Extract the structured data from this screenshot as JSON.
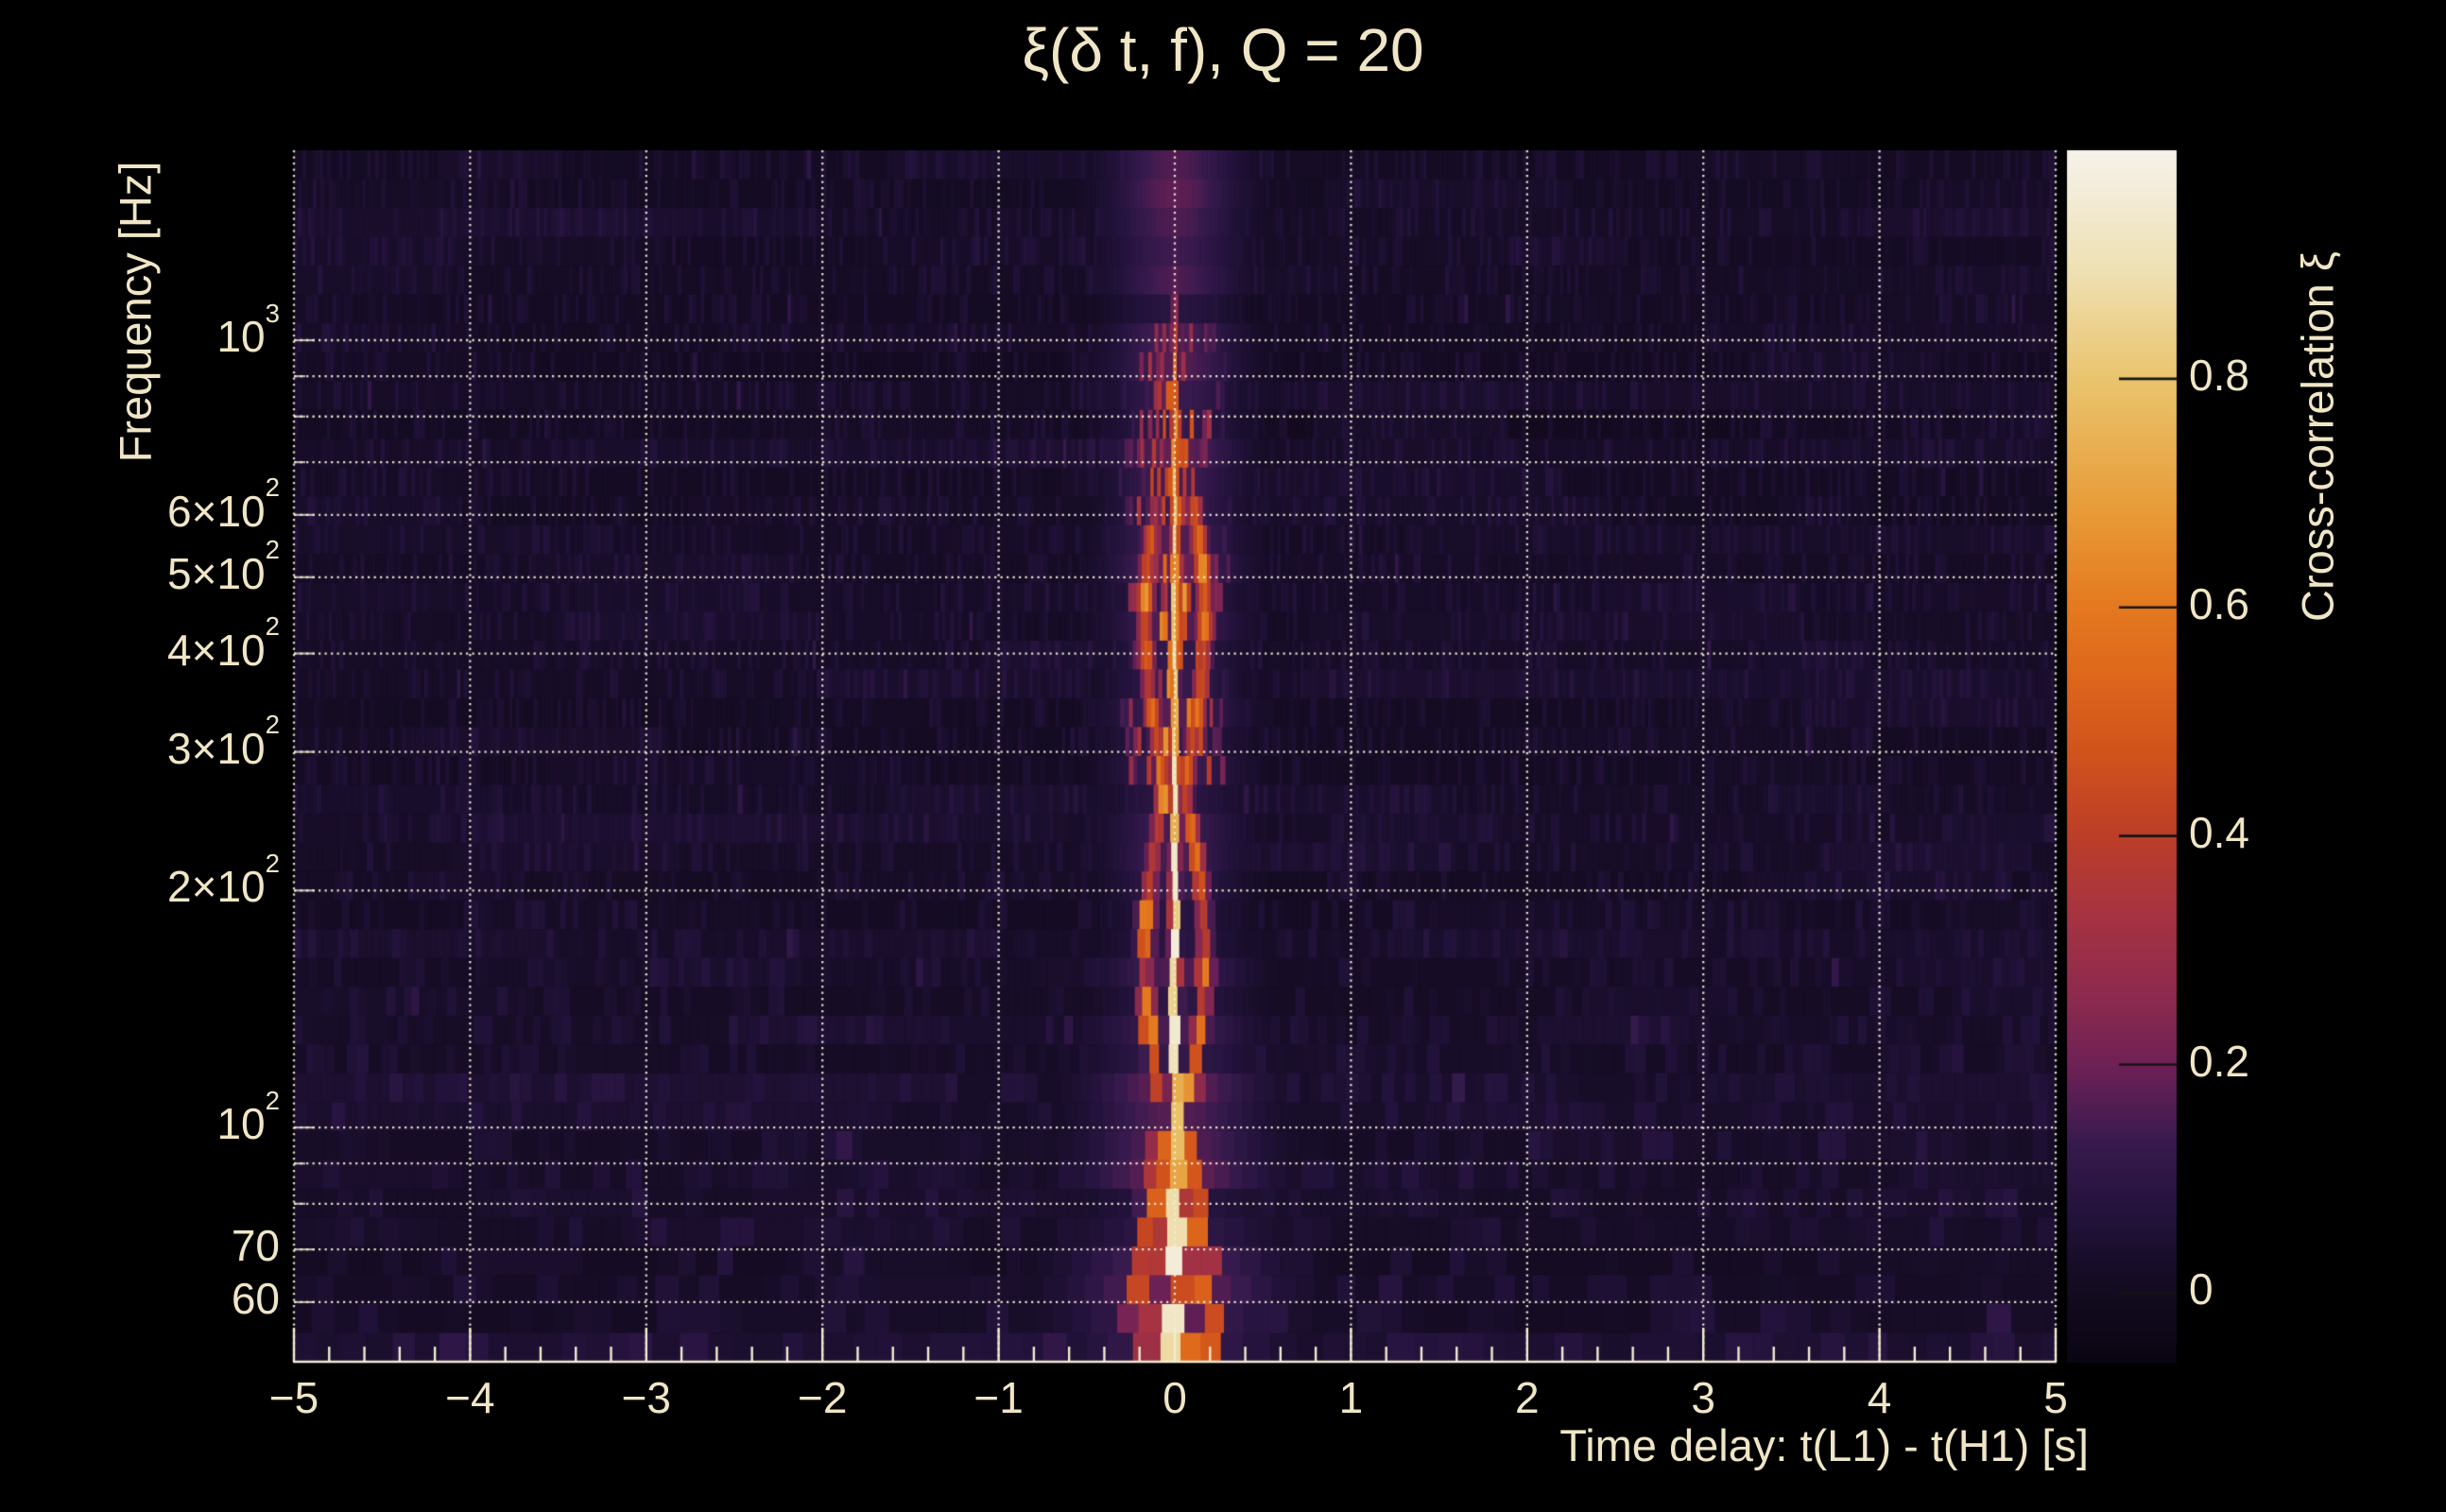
{
  "style": {
    "background": "#000000",
    "text_color": "#f0e6c6",
    "grid_color": "rgba(244,238,214,0.92)",
    "axis_color": "#f3ecd2",
    "colorbar_tick_color": "#141414"
  },
  "chart_data": {
    "type": "heatmap",
    "title": "ξ(δ t, f), Q = 20",
    "xlabel": "Time delay: t(L1) - t(H1) [s]",
    "ylabel": "Frequency [Hz]",
    "x_range": [
      -5,
      5
    ],
    "x_scale": "linear",
    "y_range_hz": [
      50.4,
      1743
    ],
    "y_scale": "log",
    "grid": true,
    "legend": "colorbar-right",
    "x_major_ticks": [
      {
        "v": -5,
        "label": "−5"
      },
      {
        "v": -4,
        "label": "−4"
      },
      {
        "v": -3,
        "label": "−3"
      },
      {
        "v": -2,
        "label": "−2"
      },
      {
        "v": -1,
        "label": "−1"
      },
      {
        "v": 0,
        "label": "0"
      },
      {
        "v": 1,
        "label": "1"
      },
      {
        "v": 2,
        "label": "2"
      },
      {
        "v": 3,
        "label": "3"
      },
      {
        "v": 4,
        "label": "4"
      },
      {
        "v": 5,
        "label": "5"
      }
    ],
    "x_minor_step": 0.2,
    "y_tick_labels": [
      {
        "value": 1000,
        "base": "10",
        "exp": "3"
      },
      {
        "value": 600,
        "base": "6×10",
        "exp": "2"
      },
      {
        "value": 500,
        "base": "5×10",
        "exp": "2"
      },
      {
        "value": 400,
        "base": "4×10",
        "exp": "2"
      },
      {
        "value": 300,
        "base": "3×10",
        "exp": "2"
      },
      {
        "value": 200,
        "base": "2×10",
        "exp": "2"
      },
      {
        "value": 100,
        "base": "10",
        "exp": "2"
      },
      {
        "value": 70,
        "base": "70",
        "exp": null
      },
      {
        "value": 60,
        "base": "60",
        "exp": null
      }
    ],
    "y_gridlines_hz": [
      60,
      70,
      80,
      90,
      100,
      200,
      300,
      400,
      500,
      600,
      700,
      800,
      900,
      1000
    ],
    "colorbar": {
      "label": "Cross-correlation ξ",
      "range": [
        -0.06,
        1.0
      ],
      "ticks": [
        {
          "v": 0.8,
          "label": "0.8"
        },
        {
          "v": 0.6,
          "label": "0.6"
        },
        {
          "v": 0.4,
          "label": "0.4"
        },
        {
          "v": 0.2,
          "label": "0.2"
        },
        {
          "v": 0.0,
          "label": "0"
        }
      ]
    },
    "colormap_stops": [
      [
        0.0,
        "#0a0512"
      ],
      [
        0.06,
        "#130b20"
      ],
      [
        0.12,
        "#22123a"
      ],
      [
        0.18,
        "#371a4e"
      ],
      [
        0.245,
        "#6e2156"
      ],
      [
        0.3,
        "#8c2a4e"
      ],
      [
        0.37,
        "#a63341"
      ],
      [
        0.434,
        "#bc3e28"
      ],
      [
        0.5,
        "#d0521c"
      ],
      [
        0.57,
        "#de681c"
      ],
      [
        0.623,
        "#e4791f"
      ],
      [
        0.7,
        "#e89a37"
      ],
      [
        0.811,
        "#e9c46d"
      ],
      [
        0.9,
        "#efe0b2"
      ],
      [
        1.0,
        "#f5f2ea"
      ]
    ],
    "signal_model": {
      "description": "Narrow cross-correlation ridge centred at zero time delay, brightest (xi ~ 1) near 55-100 Hz, braided orange side-lobes between ~110-620 Hz at |dt| ~ 0.05-0.17 s, fading orange core up to ~1 kHz and a faint purple smear above 1 kHz; dark purple striated noise (xi ~ 0-0.08) elsewhere.",
      "core_center_s": 0.0,
      "core_profile_f_amp": [
        [
          52,
          0.9
        ],
        [
          58,
          0.97
        ],
        [
          70,
          0.98
        ],
        [
          85,
          0.95
        ],
        [
          100,
          0.93
        ],
        [
          130,
          0.95
        ],
        [
          170,
          0.97
        ],
        [
          210,
          0.95
        ],
        [
          260,
          0.92
        ],
        [
          320,
          0.88
        ],
        [
          400,
          0.88
        ],
        [
          470,
          0.92
        ],
        [
          540,
          0.85
        ],
        [
          620,
          0.8
        ],
        [
          700,
          0.78
        ],
        [
          800,
          0.72
        ],
        [
          900,
          0.6
        ],
        [
          1000,
          0.45
        ],
        [
          1100,
          0.3
        ],
        [
          1250,
          0.17
        ],
        [
          1450,
          0.1
        ],
        [
          1743,
          0.07
        ]
      ],
      "core_sigma_s": {
        "base": 0.013,
        "over_f": 1.4,
        "below_57hz": 0.09
      },
      "braid_lobes": {
        "f_min": 105,
        "f_max": 640,
        "offset_s": "0.05+0.12|sin(7.3(log10 f - 2))|",
        "rel_amp": 0.62,
        "sigma_s": 0.035
      },
      "low_f_wings": {
        "f_max": 100,
        "rel_amp": 0.55,
        "sigma_s": 0.055
      },
      "halo": {
        "amp": 0.14,
        "width_s_low_f": 0.42,
        "width_s_high_f": 0.25
      },
      "noise_level": [
        0.0,
        0.08
      ],
      "rows": 42,
      "block_duration_s": "clamp(7/f, 0.022, 0.13)"
    }
  }
}
